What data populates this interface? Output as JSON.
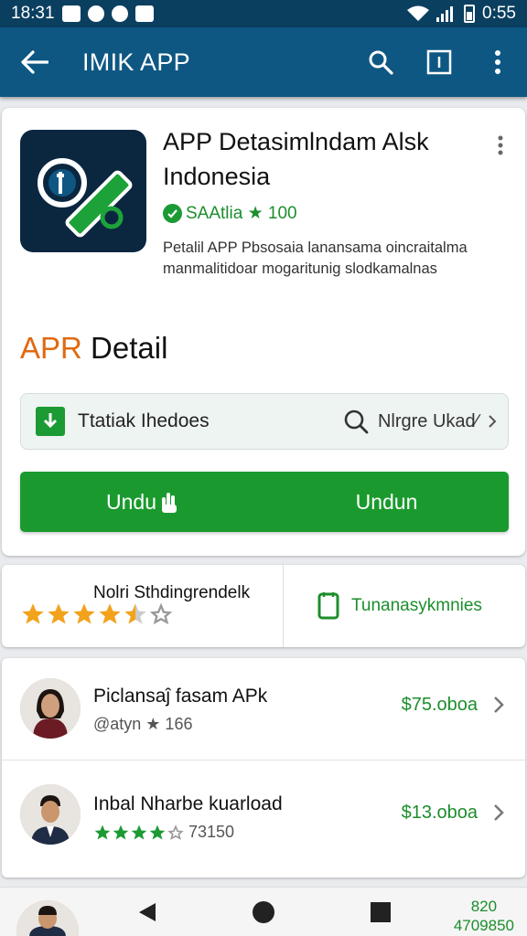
{
  "status": {
    "time": "18:31",
    "right_time": "0:55"
  },
  "appbar": {
    "title": "IMIK APP"
  },
  "app": {
    "name": "APP Detasimlndam Alsk Indonesia",
    "badge": "SAAtlia ★ 100",
    "description": "Petalil APP Pbsosaia lanansama oincraitalma manmalitidoar mogaritunig slodkamalnas"
  },
  "section": {
    "accent": "APR",
    "rest": " Detail"
  },
  "action_bar": {
    "left_label": "Ttatiak Ihedoes",
    "right_label": "Nlrgre Ukad∕"
  },
  "download": {
    "left_label": "Undu",
    "right_label": "Undun"
  },
  "rating": {
    "label": "Nolri Sthdingrendelk",
    "value": 4.5,
    "right_label": "Tunanasykmnies"
  },
  "list": [
    {
      "title": "Piclansaĵ fasam APk",
      "sub": "@atyn ★ 166",
      "price": "$75.oboa"
    },
    {
      "title": "Inbal Nharbe kuarload",
      "sub": "73150",
      "rating": 4,
      "price": "$13.oboa"
    }
  ],
  "nav": {
    "code_top": "820",
    "code_bottom": "4709850"
  },
  "colors": {
    "appbar": "#0e5783",
    "statusbar": "#0b3f60",
    "green": "#1a9a2e",
    "accent": "#e06a12",
    "star": "#f2a21b"
  },
  "icons": [
    "back-arrow-icon",
    "search-icon",
    "tab-icon",
    "more-vert-icon",
    "download-icon",
    "hand-icon",
    "search-icon",
    "chevron-right-icon",
    "phone-icon",
    "back-nav-icon",
    "home-nav-icon",
    "recents-nav-icon"
  ]
}
